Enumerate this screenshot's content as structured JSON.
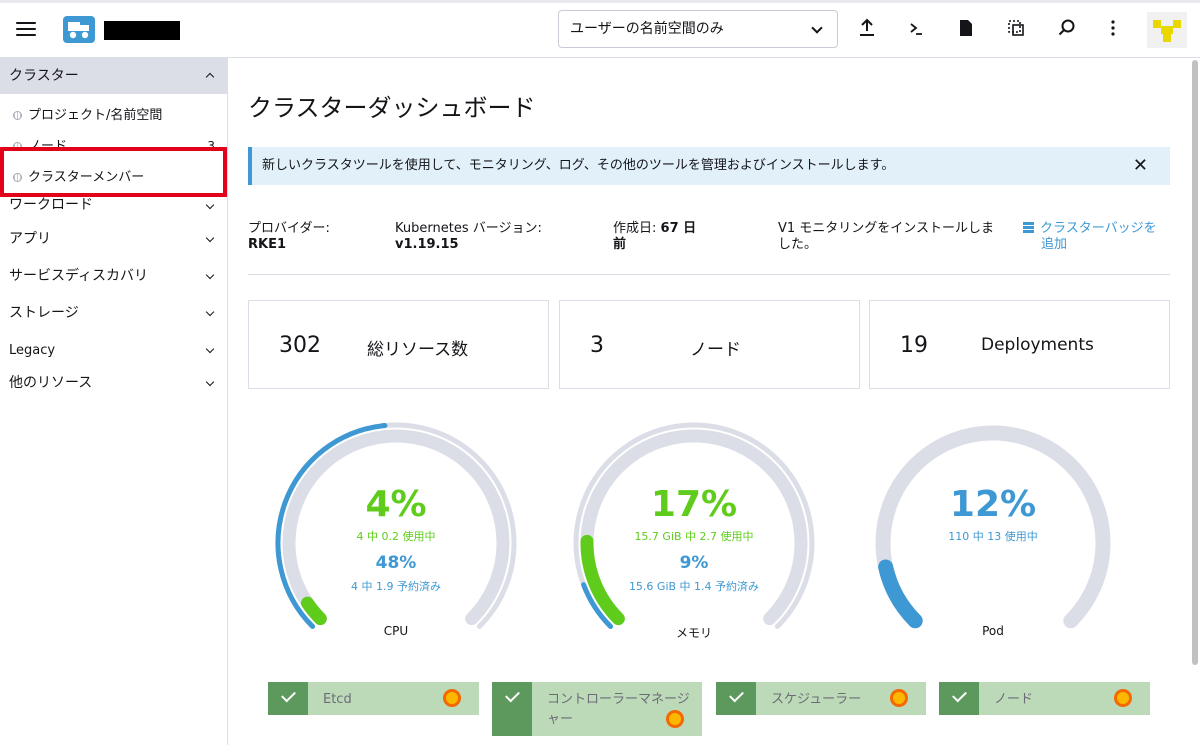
{
  "header": {
    "namespace_filter": "ユーザーの名前空間のみ",
    "icons": [
      "menu-icon",
      "upload-icon",
      "shell-icon",
      "file-icon",
      "copy-config-icon",
      "search-icon",
      "more-icon"
    ]
  },
  "sidebar": {
    "section": "クラスター",
    "items": [
      {
        "label": "プロジェクト/名前空間",
        "count": ""
      },
      {
        "label": "ノード",
        "count": "3"
      },
      {
        "label": "クラスターメンバー",
        "count": ""
      }
    ],
    "groups": [
      "ワークロード",
      "アプリ",
      "サービスディスカバリ",
      "ストレージ",
      "Legacy",
      "他のリソース"
    ]
  },
  "main": {
    "title": "クラスターダッシュボード",
    "banner": "新しいクラスタツールを使用して、モニタリング、ログ、その他のツールを管理およびインストールします。",
    "info": {
      "provider_label": "プロバイダー:",
      "provider_value": "RKE1",
      "k8s_label": "Kubernetes バージョン:",
      "k8s_value": "v1.19.15",
      "created_label": "作成日:",
      "created_value": "67 日",
      "created_value2": "前",
      "monitoring_line1": "V1 モニタリングをインストールしま",
      "monitoring_line2": "した。",
      "badge_line1": "クラスターバッジを",
      "badge_line2": "追加"
    },
    "cards": [
      {
        "num": "302",
        "label": "総リソース数"
      },
      {
        "num": "3",
        "label": "ノード"
      },
      {
        "num": "19",
        "label": "Deployments"
      }
    ],
    "gauges": [
      {
        "name": "CPU",
        "used_pct": "4%",
        "used_text": "4 中 0.2 使用中",
        "reserved_pct": "48%",
        "reserved_text": "4 中 1.9 予約済み",
        "used_fraction": 0.04,
        "reserved_fraction": 0.48
      },
      {
        "name": "メモリ",
        "used_pct": "17%",
        "used_text": "15.7 GiB 中 2.7 使用中",
        "reserved_pct": "9%",
        "reserved_text": "15.6 GiB 中 1.4 予約済み",
        "used_fraction": 0.17,
        "reserved_fraction": 0.09
      },
      {
        "name": "Pod",
        "used_pct": "12%",
        "used_text": "110 中 13 使用中",
        "reserved_pct": "",
        "reserved_text": "",
        "used_fraction": 0.12,
        "reserved_fraction": 0
      }
    ],
    "status": [
      {
        "label": "Etcd"
      },
      {
        "label": "コントローラーマネージ",
        "label2": "ャー"
      },
      {
        "label": "スケジューラー"
      },
      {
        "label": "ノード"
      }
    ]
  },
  "colors": {
    "accent": "#3d98d3",
    "green": "#5fcc1c",
    "highlight": "#e2001a"
  }
}
